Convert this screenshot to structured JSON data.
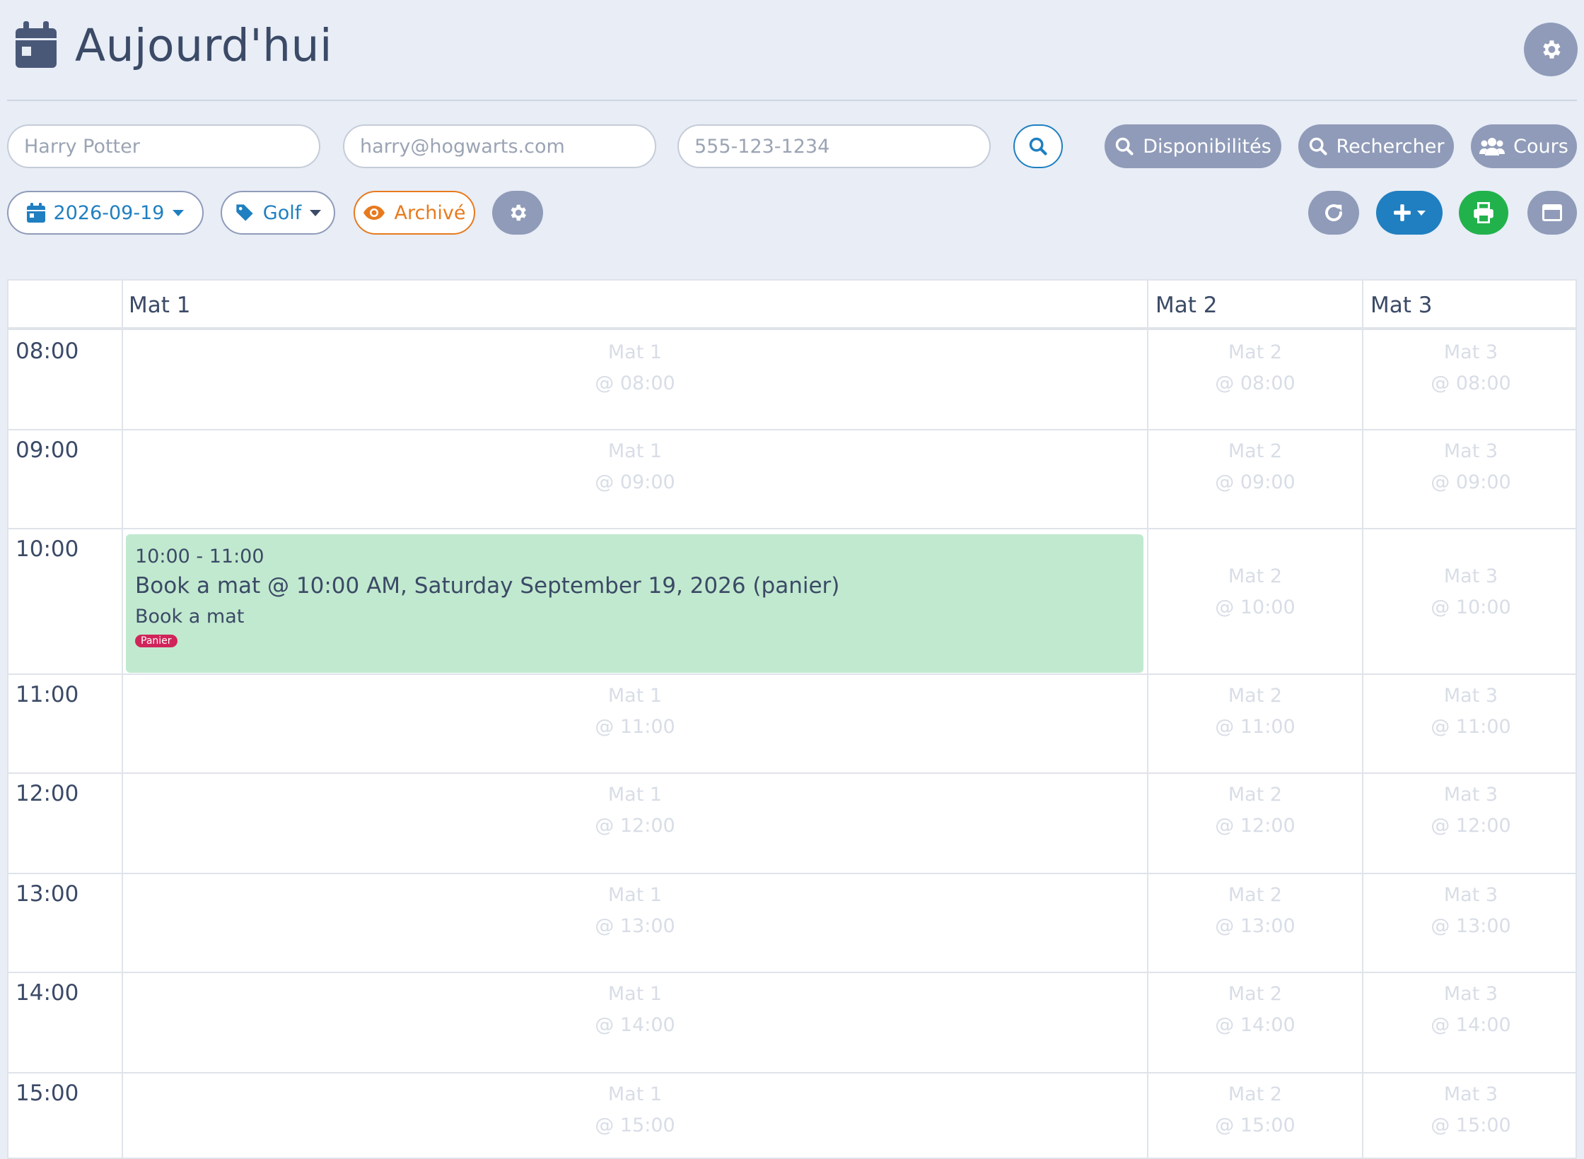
{
  "header": {
    "title": "Aujourd'hui"
  },
  "filters": {
    "name_placeholder": "Harry Potter",
    "email_placeholder": "harry@hogwarts.com",
    "phone_placeholder": "555-123-1234",
    "availability_label": "Disponibilités",
    "search_label": "Rechercher",
    "courses_label": "Cours"
  },
  "toolbar": {
    "date": "2026-09-19",
    "category": "Golf",
    "archived_label": "Archivé"
  },
  "columns": [
    "Mat 1",
    "Mat 2",
    "Mat 3"
  ],
  "times": [
    "08:00",
    "09:00",
    "10:00",
    "11:00",
    "12:00",
    "13:00",
    "14:00",
    "15:00"
  ],
  "slot_prefix": "@",
  "event": {
    "time_range": "10:00 - 11:00",
    "title": "Book a mat @ 10:00 AM, Saturday September 19, 2026 (panier)",
    "subtitle": "Book a mat",
    "badge": "Panier"
  },
  "colors": {
    "background": "#e8edf6",
    "primary": "#1f7fc0",
    "muted_button": "#8f9bb8",
    "archived_orange": "#e77a1e",
    "print_green": "#22b24c",
    "event_green": "#c1e9cf",
    "badge_red": "#d0245a"
  },
  "icons": {
    "header": "calendar-icon",
    "settings": "gear-icon",
    "search": "search-icon",
    "users": "users-icon",
    "tag": "tag-icon",
    "eye": "eye-icon",
    "refresh": "refresh-icon",
    "add": "plus-icon",
    "print": "print-icon",
    "window": "window-icon"
  }
}
